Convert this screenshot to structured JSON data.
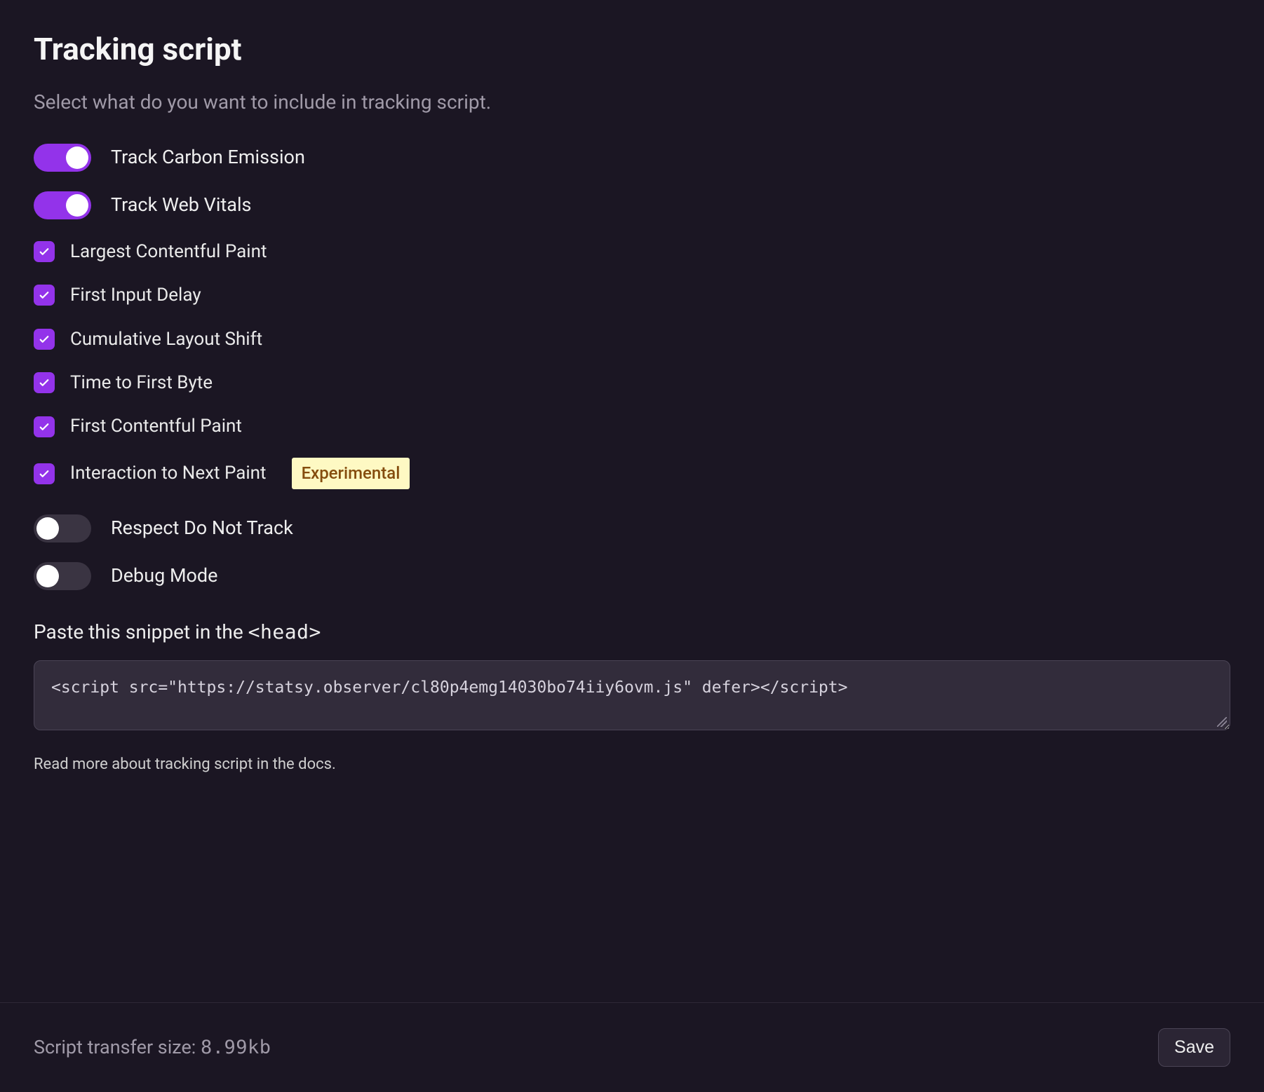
{
  "title": "Tracking script",
  "subtitle": "Select what do you want to include in tracking script.",
  "toggles": {
    "carbon": {
      "label": "Track Carbon Emission",
      "on": true
    },
    "webvitals": {
      "label": "Track Web Vitals",
      "on": true
    },
    "dnt": {
      "label": "Respect Do Not Track",
      "on": false
    },
    "debug": {
      "label": "Debug Mode",
      "on": false
    }
  },
  "vitals": [
    {
      "label": "Largest Contentful Paint",
      "checked": true
    },
    {
      "label": "First Input Delay",
      "checked": true
    },
    {
      "label": "Cumulative Layout Shift",
      "checked": true
    },
    {
      "label": "Time to First Byte",
      "checked": true
    },
    {
      "label": "First Contentful Paint",
      "checked": true
    },
    {
      "label": "Interaction to Next Paint",
      "checked": true,
      "badge": "Experimental"
    }
  ],
  "snippet": {
    "label_prefix": "Paste this snippet in the ",
    "label_code": "<head>",
    "code": "<script src=\"https://statsy.observer/cl80p4emg14030bo74iiy6ovm.js\" defer></script>"
  },
  "docs_hint": "Read more about tracking script in the docs.",
  "footer": {
    "transfer_prefix": "Script transfer size: ",
    "transfer_size": "8.99kb",
    "save_label": "Save"
  }
}
